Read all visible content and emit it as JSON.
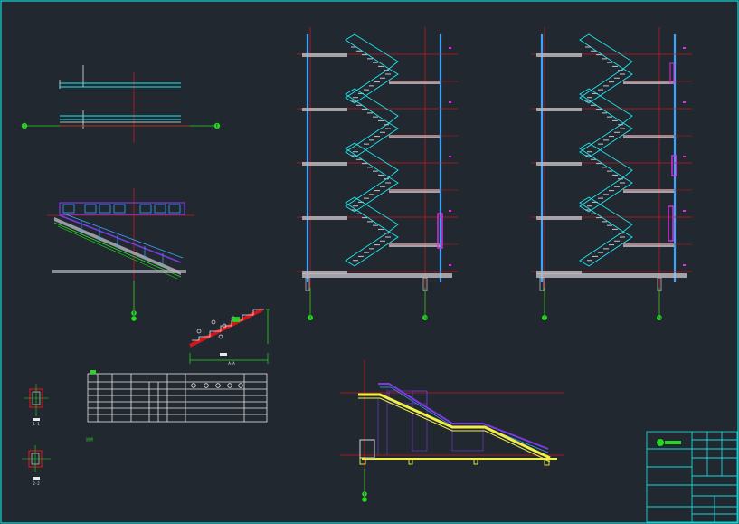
{
  "drawing": {
    "colors": {
      "background": "#212830",
      "frame": "#17d8d8",
      "red": "#d0161b",
      "cyan": "#1ee8ef",
      "blue": "#39a5ff",
      "white": "#e8e8e8",
      "gray": "#b8b8c0",
      "green": "#26d81e",
      "magenta": "#e02fe6",
      "yellow": "#f0f046",
      "purple": "#7a3be0"
    },
    "axis_labels": {
      "plan_left": "E",
      "plan_right": "E",
      "stair_detail_bottom": "B",
      "elev1_left": "7",
      "elev1_right": "10",
      "elev2_left": "7",
      "elev2_right": "10",
      "section_bottom": "B"
    },
    "dimension_label": "A-A",
    "small_detail_labels": [
      "1-1",
      "2-2"
    ],
    "side_note": "說明",
    "title_block": {
      "logo": "logo-mark",
      "rows": 10
    }
  }
}
